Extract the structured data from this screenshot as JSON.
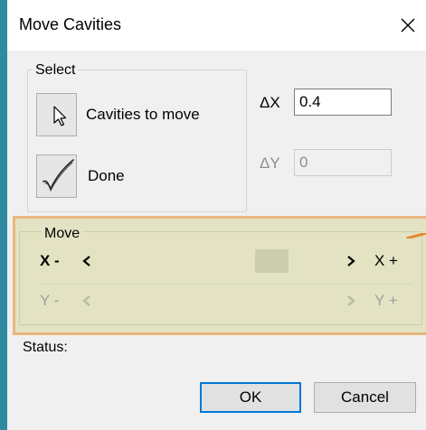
{
  "window": {
    "title": "Move Cavities"
  },
  "select_group": {
    "label": "Select",
    "cavities_button_label": "Cavities to move",
    "done_button_label": "Done"
  },
  "delta": {
    "dx_label": "ΔX",
    "dx_value": "0.4",
    "dy_label": "ΔY",
    "dy_value": "0"
  },
  "move_group": {
    "label": "Move",
    "x_minus": "X -",
    "x_plus": "X +",
    "y_minus": "Y -",
    "y_plus": "Y +"
  },
  "status": {
    "label": "Status:"
  },
  "buttons": {
    "ok": "OK",
    "cancel": "Cancel"
  },
  "colors": {
    "highlight_fill": "#e3e3c3",
    "highlight_border": "#e9b67e",
    "callout_arrow": "#e8862a",
    "focus_border": "#0078d7"
  }
}
